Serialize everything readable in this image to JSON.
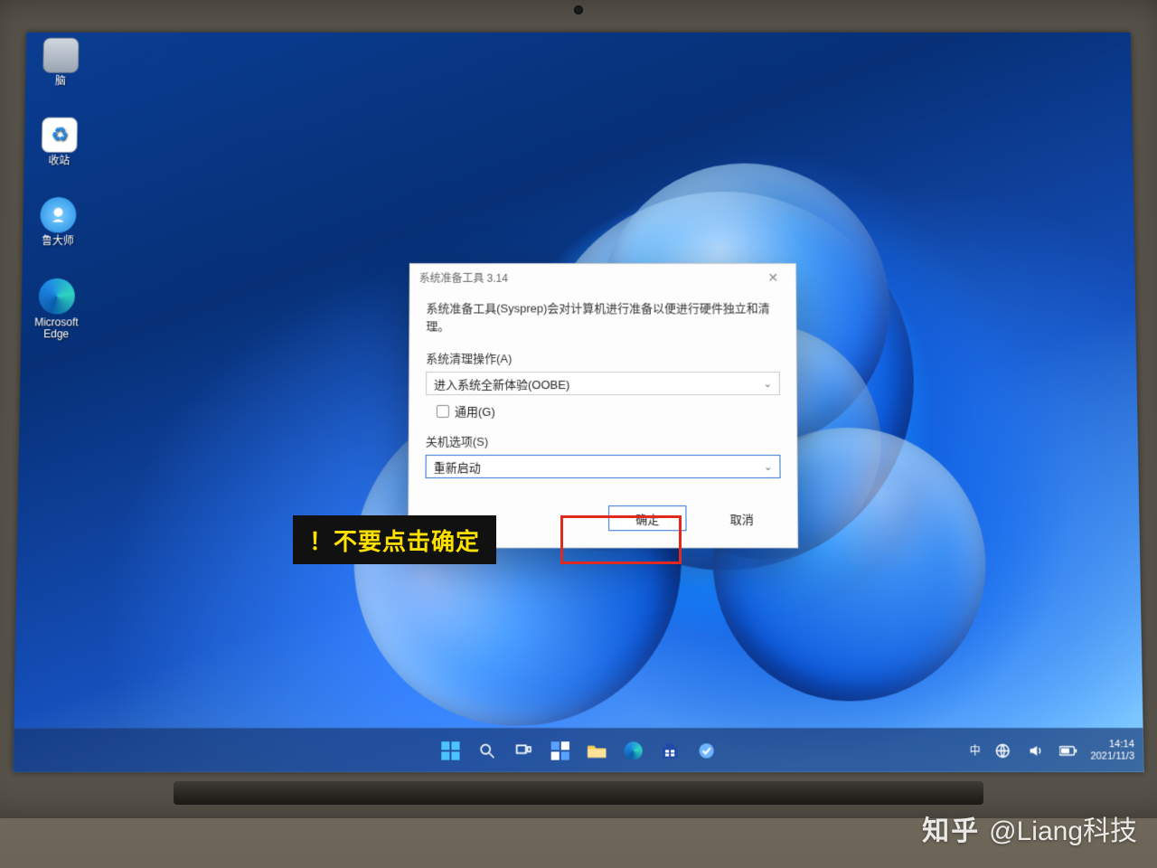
{
  "desktop": {
    "icons": [
      {
        "label": "脑"
      },
      {
        "label": "收站"
      },
      {
        "label": "鲁大师"
      },
      {
        "label": "Microsoft Edge"
      }
    ]
  },
  "dialog": {
    "title": "系统准备工具 3.14",
    "description": "系统准备工具(Sysprep)会对计算机进行准备以便进行硬件独立和清理。",
    "cleanup_label": "系统清理操作(A)",
    "cleanup_value": "进入系统全新体验(OOBE)",
    "generalize_label": "通用(G)",
    "shutdown_label": "关机选项(S)",
    "shutdown_value": "重新启动",
    "ok": "确定",
    "cancel": "取消"
  },
  "annotation": {
    "caption": "！不要点击确定"
  },
  "tray": {
    "ime": "中",
    "time": "14:14",
    "date": "2021/11/3"
  },
  "watermark": {
    "site": "知乎",
    "handle": "@Liang科技"
  }
}
